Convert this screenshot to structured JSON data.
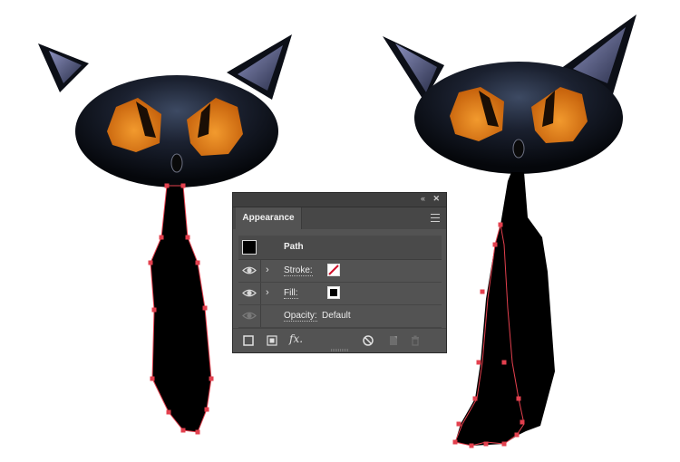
{
  "panel": {
    "tab_label": "Appearance",
    "icons": {
      "collapse": "double-chevron-left-icon",
      "close": "close-icon",
      "menu": "hamburger-menu-icon"
    },
    "collapse_glyph": "‹‹",
    "close_glyph": "✕",
    "path_label": "Path",
    "rows": [
      {
        "label": "Stroke:",
        "swatch": "none-red-slash",
        "has_eye": true,
        "has_chevron": true
      },
      {
        "label": "Fill:",
        "swatch": "black",
        "has_eye": true,
        "has_chevron": true
      },
      {
        "label": "Opacity:",
        "value": "Default",
        "has_eye": true,
        "has_chevron": false
      }
    ],
    "chevron_glyph": "›",
    "footer_icons": [
      "add-new-stroke-icon",
      "add-new-fill-icon",
      "fx-effects-icon",
      "clear-appearance-icon",
      "duplicate-item-icon",
      "delete-item-icon"
    ],
    "fx_label": "fx."
  },
  "colors": {
    "panel_bg": "#535353",
    "anchor": "#e3404e",
    "eye_orange": "#e07b17",
    "cat_body": "#000000"
  }
}
